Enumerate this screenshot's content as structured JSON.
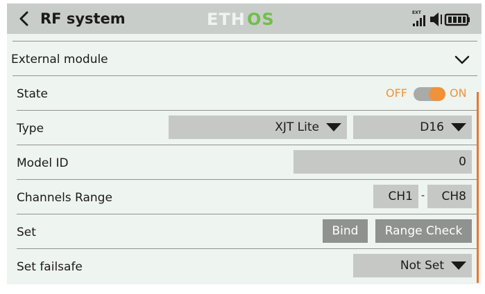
{
  "header": {
    "title": "RF system",
    "logo_text": "ETHOS",
    "ext_label": "EXT"
  },
  "section": {
    "label": "External module"
  },
  "rows": {
    "state": {
      "label": "State",
      "off_label": "OFF",
      "on_label": "ON",
      "value": true
    },
    "type": {
      "label": "Type",
      "module_value": "XJT Lite",
      "mode_value": "D16"
    },
    "model_id": {
      "label": "Model ID",
      "value": "0"
    },
    "channels_range": {
      "label": "Channels Range",
      "start": "CH1",
      "separator": "-",
      "end": "CH8"
    },
    "set": {
      "label": "Set",
      "bind_label": "Bind",
      "range_check_label": "Range Check"
    },
    "failsafe": {
      "label": "Set failsafe",
      "value": "Not Set"
    }
  },
  "colors": {
    "accent": "#f0923a",
    "scrollbar": "#e8762e",
    "header_bg": "#c9cdc9",
    "screen_bg": "#eef4ef",
    "field_bg": "#c6c8c6",
    "button_bg": "#8f928f"
  }
}
